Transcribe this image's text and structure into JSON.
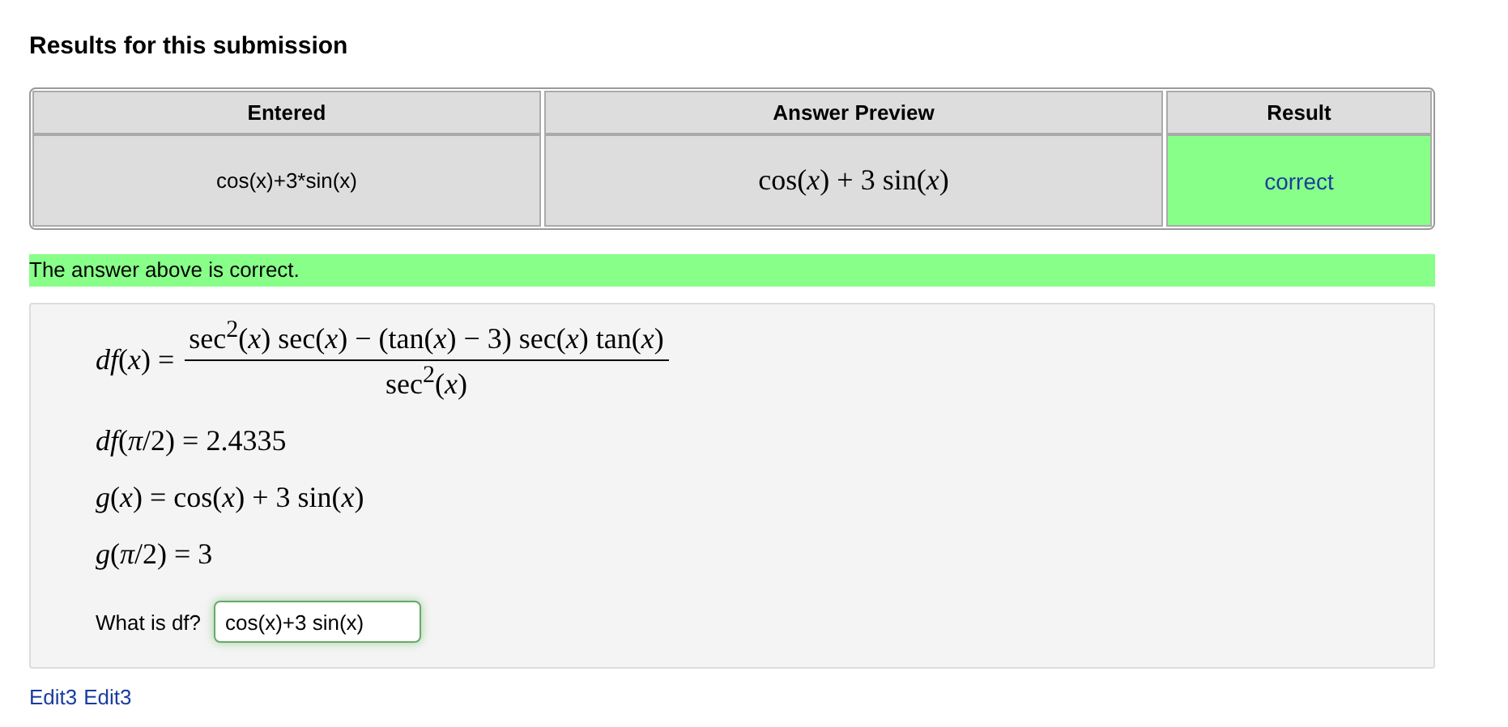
{
  "title": "Results for this submission",
  "table": {
    "columns": [
      "Entered",
      "Answer Preview",
      "Result"
    ],
    "rows": [
      {
        "entered": "cos(x)+3*sin(x)",
        "preview": "cos(*x*) + 3 sin(*x*)",
        "result": "correct",
        "correct": true
      }
    ]
  },
  "message": {
    "text": "The answer above is correct.",
    "correct": true
  },
  "solution": [
    {
      "kind": "fraction",
      "lhs": "*df*(*x*) =",
      "numerator": "sec$^{2}$(*x*) sec(*x*) − (tan(*x*) − 3) sec(*x*) tan(*x*)",
      "denominator": "sec$^{2}$(*x*)"
    },
    {
      "kind": "equation",
      "text": "*df*(*π*/2) = 2.4335"
    },
    {
      "kind": "equation",
      "text": "*g*(*x*) = cos(*x*) + 3 sin(*x*)"
    },
    {
      "kind": "equation",
      "text": "*g*(*π*/2) = 3"
    }
  ],
  "question": {
    "label": "What is df?",
    "value": "cos(x)+3 sin(x)"
  },
  "links": [
    "Edit3",
    "Edit3"
  ]
}
